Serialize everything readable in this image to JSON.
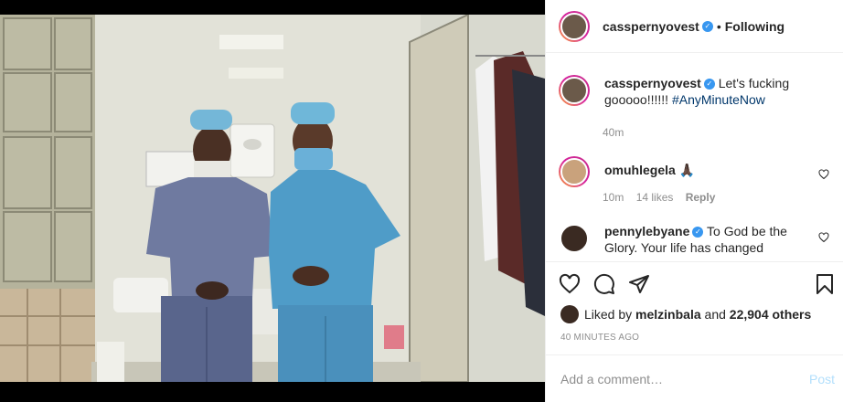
{
  "header": {
    "username": "casspernyovest",
    "separator": "•",
    "follow_status": "Following"
  },
  "comments": [
    {
      "username": "casspernyovest",
      "text": "Let's fucking gooooo!!!!!! ",
      "hashtag": "#AnyMinuteNow",
      "time": "40m"
    },
    {
      "username": "omuhlegela",
      "text": "🙏🏿",
      "time": "10m",
      "likes": "14 likes",
      "reply": "Reply"
    },
    {
      "username": "pennylebyane",
      "text": "To God be the Glory. Your life has changed"
    }
  ],
  "likes": {
    "prefix": "Liked by ",
    "user": "melzinbala",
    "middle": " and ",
    "count": "22,904 others"
  },
  "timestamp": "40 MINUTES AGO",
  "add_comment": {
    "placeholder": "Add a comment…",
    "post_label": "Post"
  },
  "colors": {
    "verified": "#3897f0",
    "hashtag": "#00376b",
    "post_disabled": "#b2dffc"
  }
}
